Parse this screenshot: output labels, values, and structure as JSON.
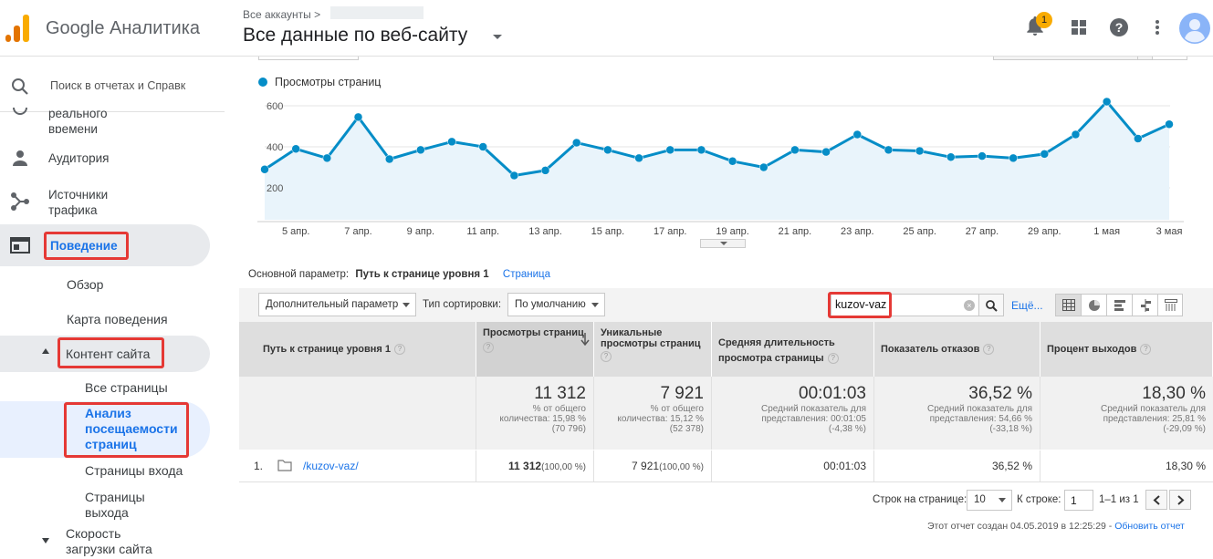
{
  "header": {
    "logo_text": "Google Аналитика",
    "breadcrumb": "Все аккаунты",
    "view_title": "Все данные по веб-сайту",
    "notification_count": "1",
    "colors": {
      "logo_orange": "#f9ab00",
      "logo_dark": "#e37400"
    }
  },
  "sidebar": {
    "search_placeholder": "Поиск в отчетах и Справк",
    "items": {
      "realtime": "реального\nвремени",
      "audience": "Аудитория",
      "acquisition_l1": "Источники",
      "acquisition_l2": "трафика",
      "behavior": "Поведение",
      "overview": "Обзор",
      "behavior_flow": "Карта поведения",
      "site_content": "Контент сайта",
      "all_pages": "Все страницы",
      "page_analytics_l1": "Анализ",
      "page_analytics_l2": "посещаемости",
      "page_analytics_l3": "страниц",
      "landing_pages": "Страницы входа",
      "exit_pages_l1": "Страницы",
      "exit_pages_l2": "выхода",
      "site_speed_l1": "Скорость",
      "site_speed_l2": "загрузки сайта"
    }
  },
  "chart_data": {
    "type": "line",
    "series": [
      {
        "name": "Просмотры страниц",
        "values": [
          290,
          390,
          345,
          545,
          340,
          385,
          425,
          400,
          260,
          285,
          420,
          385,
          345,
          385,
          385,
          330,
          300,
          385,
          375,
          460,
          385,
          380,
          350,
          355,
          345,
          365,
          460,
          620,
          440,
          510
        ]
      }
    ],
    "x_tick_labels": [
      "5 апр.",
      "7 апр.",
      "9 апр.",
      "11 апр.",
      "13 апр.",
      "15 апр.",
      "17 апр.",
      "19 апр.",
      "21 апр.",
      "23 апр.",
      "25 апр.",
      "27 апр.",
      "29 апр.",
      "1 мая",
      "3 мая"
    ],
    "y_tick_labels": [
      "600",
      "400",
      "200"
    ],
    "ylim": [
      0,
      650
    ],
    "color": "#058dc7"
  },
  "dimension": {
    "label": "Основной параметр:",
    "active": "Путь к странице уровня 1",
    "other": "Страница"
  },
  "controls": {
    "secondary_dimension": "Дополнительный параметр",
    "sort_label": "Тип сортировки:",
    "sort_value": "По умолчанию",
    "search_value": "kuzov-vaz",
    "more_link": "Ещё..."
  },
  "table": {
    "headers": {
      "dimension": "Путь к странице уровня 1",
      "pageviews": "Просмотры страниц",
      "unique": "Уникальные просмотры страниц",
      "avg_time": "Средняя длительность просмотра страницы",
      "bounce": "Показатель отказов",
      "exit": "Процент выходов"
    },
    "totals": {
      "pageviews": "11 312",
      "pageviews_sub1": "% от общего",
      "pageviews_sub2": "количества: 15,98 %",
      "pageviews_sub3": "(70 796)",
      "unique": "7 921",
      "unique_sub1": "% от общего",
      "unique_sub2": "количества: 15,12 %",
      "unique_sub3": "(52 378)",
      "avg_time": "00:01:03",
      "avg_time_sub1": "Средний показатель для",
      "avg_time_sub2": "представления: 00:01:05",
      "avg_time_sub3": "(-4,38 %)",
      "bounce": "36,52 %",
      "bounce_sub1": "Средний показатель для",
      "bounce_sub2": "представления: 54,66 %",
      "bounce_sub3": "(-33,18 %)",
      "exit": "18,30 %",
      "exit_sub1": "Средний показатель для",
      "exit_sub2": "представления: 25,81 %",
      "exit_sub3": "(-29,09 %)"
    },
    "row": {
      "index": "1.",
      "path": "/kuzov-vaz/",
      "pageviews": "11 312",
      "pageviews_pct": "(100,00 %)",
      "unique": "7 921",
      "unique_pct": "(100,00 %)",
      "avg_time": "00:01:03",
      "bounce": "36,52 %",
      "exit": "18,30 %"
    }
  },
  "pager": {
    "rows_label": "Строк на странице:",
    "rows_value": "10",
    "goto_label": "К строке:",
    "goto_value": "1",
    "range": "1–1 из 1"
  },
  "footer": {
    "created": "Этот отчет создан 04.05.2019 в 12:25:29 -",
    "refresh": "Обновить отчет"
  }
}
